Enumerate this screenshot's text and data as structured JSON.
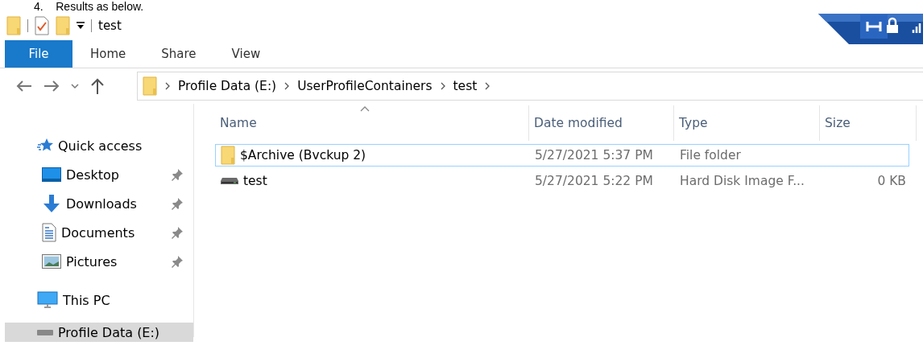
{
  "caption": "4.    Results as below.",
  "quick_access_toolbar": {
    "title": "test"
  },
  "ribbon": {
    "tabs": [
      {
        "label": "File",
        "selected": true
      },
      {
        "label": "Home",
        "selected": false
      },
      {
        "label": "Share",
        "selected": false
      },
      {
        "label": "View",
        "selected": false
      }
    ]
  },
  "address_bar": {
    "crumbs": [
      "Profile Data (E:)",
      "UserProfileContainers",
      "test"
    ]
  },
  "sidebar": {
    "items": [
      {
        "label": "Quick access",
        "kind": "quick",
        "selected": false,
        "children": [
          {
            "label": "Desktop",
            "kind": "desktop",
            "pinned": true,
            "selected": false
          },
          {
            "label": "Downloads",
            "kind": "downloads",
            "pinned": true,
            "selected": false
          },
          {
            "label": "Documents",
            "kind": "documents",
            "pinned": true,
            "selected": false
          },
          {
            "label": "Pictures",
            "kind": "pictures",
            "pinned": true,
            "selected": false
          }
        ]
      },
      {
        "label": "This PC",
        "kind": "pc",
        "selected": false
      },
      {
        "label": "Profile Data (E:)",
        "kind": "drive",
        "selected": true
      }
    ]
  },
  "file_list": {
    "columns": [
      {
        "label": "Name",
        "sorted": true
      },
      {
        "label": "Date modified",
        "sorted": false
      },
      {
        "label": "Type",
        "sorted": false
      },
      {
        "label": "Size",
        "sorted": false
      }
    ],
    "rows": [
      {
        "kind": "folder",
        "name": "$Archive (Bvckup 2)",
        "date": "5/27/2021 5:37 PM",
        "type": "File folder",
        "selected": true
      },
      {
        "kind": "disk",
        "name": "test",
        "date": "5/27/2021 5:22 PM",
        "type": "Hard Disk Image F...",
        "size": "0 KB",
        "selected": false
      }
    ]
  }
}
